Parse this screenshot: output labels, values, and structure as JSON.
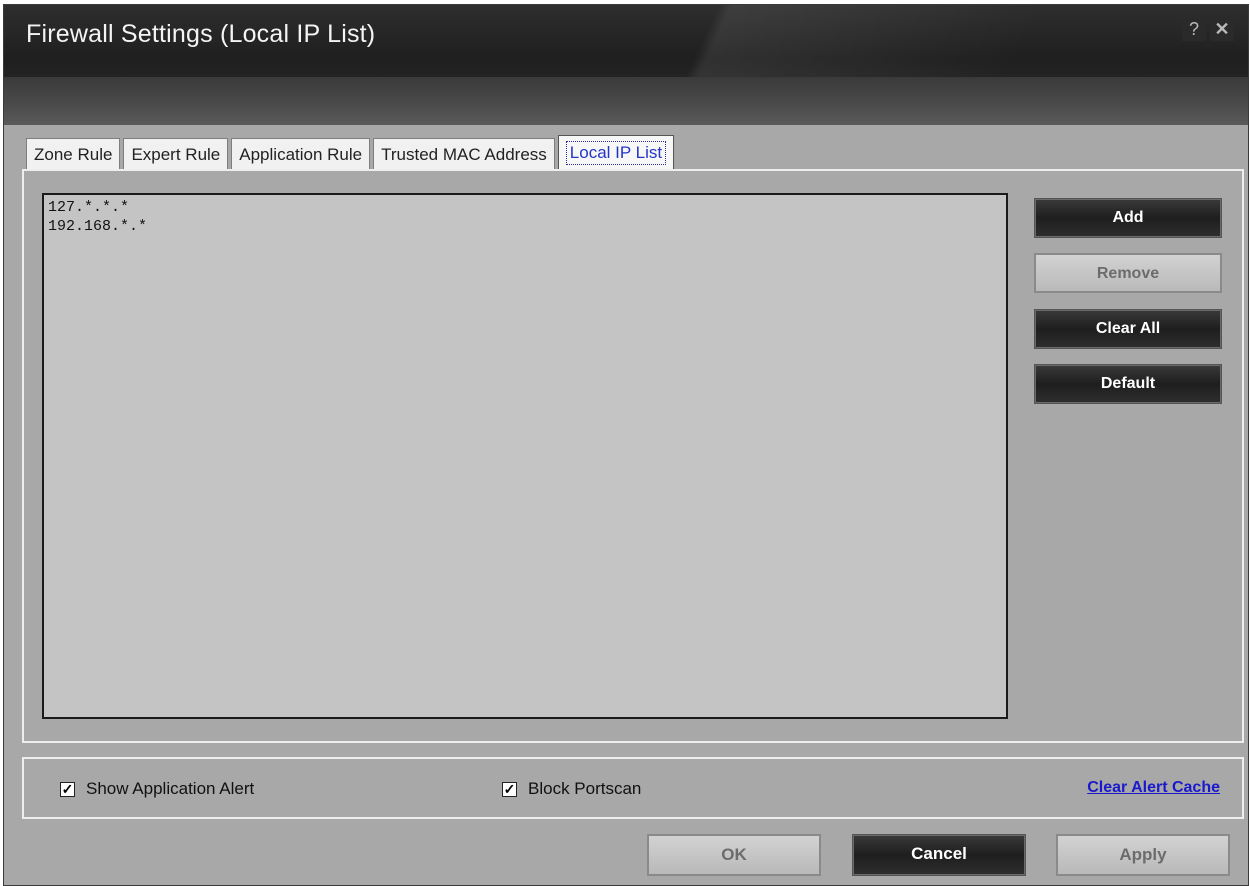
{
  "window": {
    "title": "Firewall Settings (Local IP List)",
    "help_label": "?",
    "close_label": "✕"
  },
  "tabs": [
    {
      "label": "Zone Rule",
      "active": false
    },
    {
      "label": "Expert Rule",
      "active": false
    },
    {
      "label": "Application Rule",
      "active": false
    },
    {
      "label": "Trusted MAC Address",
      "active": false
    },
    {
      "label": "Local IP List",
      "active": true
    }
  ],
  "ip_list": {
    "items": [
      "127.*.*.*",
      "192.168.*.*"
    ]
  },
  "side_buttons": {
    "add": "Add",
    "remove": "Remove",
    "clear_all": "Clear All",
    "default": "Default"
  },
  "options": {
    "show_app_alert": {
      "label": "Show Application Alert",
      "checked": true
    },
    "block_portscan": {
      "label": "Block Portscan",
      "checked": true
    },
    "clear_alert_cache": "Clear Alert Cache"
  },
  "footer": {
    "ok": "OK",
    "cancel": "Cancel",
    "apply": "Apply"
  },
  "colors": {
    "active_tab_text": "#2336c8",
    "link": "#1a1acc",
    "panel_bg": "#a8a8a8",
    "list_bg": "#c4c4c4"
  }
}
